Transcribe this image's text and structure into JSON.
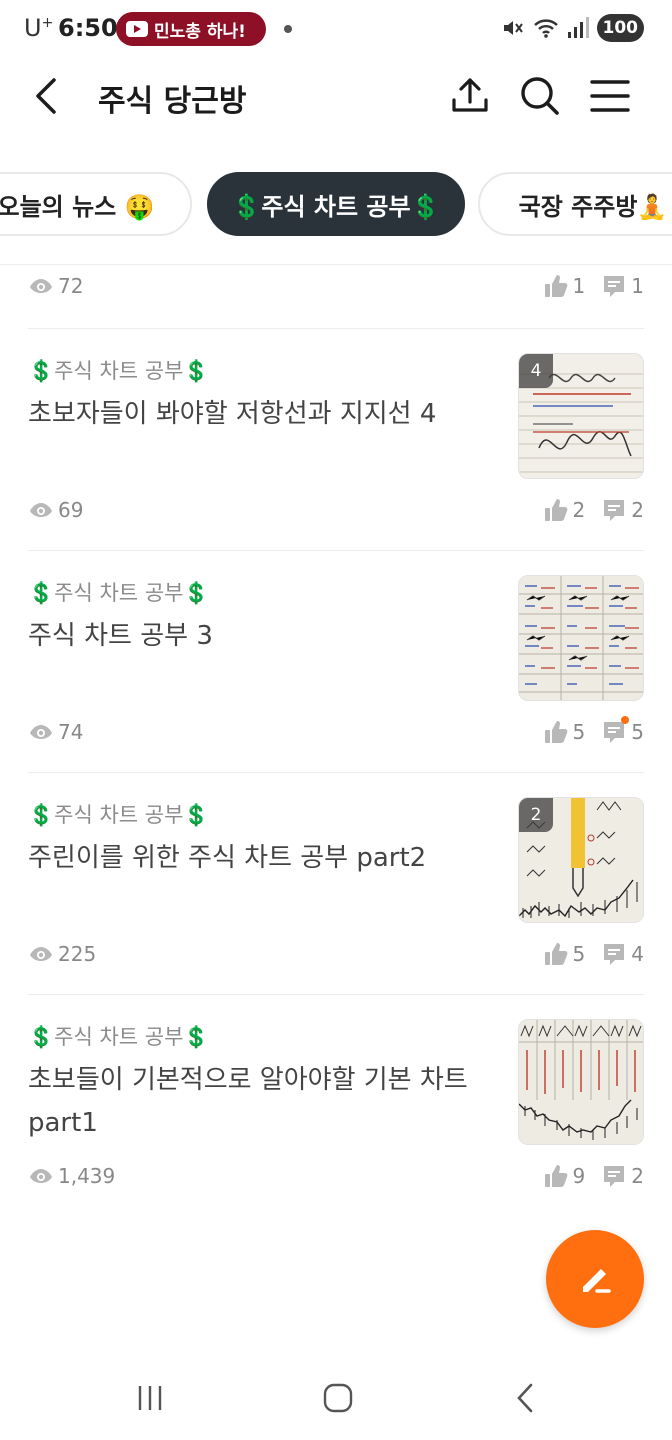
{
  "status_bar": {
    "carrier": "U",
    "carrier_sup": "+",
    "time": "6:50",
    "notification_pill": "민노총 하나!",
    "battery": "100"
  },
  "header": {
    "title": "주식 당근방"
  },
  "tabs": [
    {
      "label": "오늘의 뉴스 🤑",
      "active": false
    },
    {
      "label": "💲주식 차트 공부💲",
      "active": true
    },
    {
      "label": "국장 주주방🧘",
      "active": false
    }
  ],
  "posts": [
    {
      "views": "72",
      "likes": "1",
      "comments": "1"
    },
    {
      "category": "💲주식 차트 공부💲",
      "title": "초보자들이 봐야할 저항선과 지지선 4",
      "thumb_count": "4",
      "views": "69",
      "likes": "2",
      "comments": "2"
    },
    {
      "category": "💲주식 차트 공부💲",
      "title": "주식 차트 공부 3",
      "thumb_count": "",
      "views": "74",
      "likes": "5",
      "comments": "5",
      "new_comment": true
    },
    {
      "category": "💲주식 차트 공부💲",
      "title": "주린이를 위한 주식 차트 공부 part2",
      "thumb_count": "2",
      "views": "225",
      "likes": "5",
      "comments": "4"
    },
    {
      "category": "💲주식 차트 공부💲",
      "title": "초보들이 기본적으로 알아야할 기본 차트 part1",
      "thumb_count": "",
      "views": "1,439",
      "likes": "9",
      "comments": "2"
    }
  ],
  "colors": {
    "accent": "#ff6f0f",
    "active_tab": "#2a323a",
    "pill": "#8d1026"
  },
  "icons": [
    "back-arrow-icon",
    "share-icon",
    "search-icon",
    "menu-icon",
    "eye-icon",
    "thumbs-up-icon",
    "comment-icon",
    "pencil-icon",
    "recent-apps-icon",
    "home-icon",
    "back-icon"
  ]
}
